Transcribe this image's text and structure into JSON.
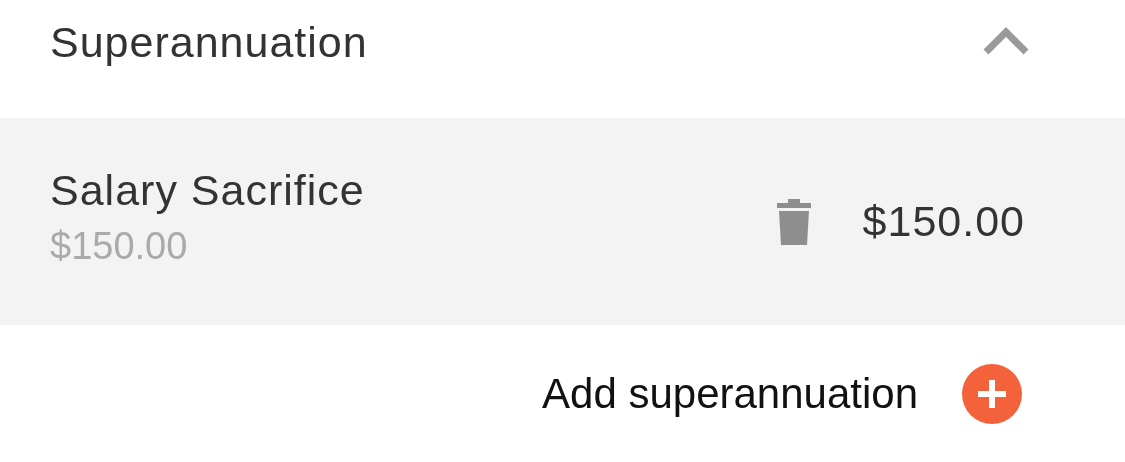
{
  "section": {
    "title": "Superannuation",
    "expanded": true
  },
  "items": [
    {
      "name": "Salary Sacrifice",
      "subtitle": "$150.00",
      "amount": "$150.00"
    }
  ],
  "add_button": {
    "label": "Add superannuation"
  }
}
